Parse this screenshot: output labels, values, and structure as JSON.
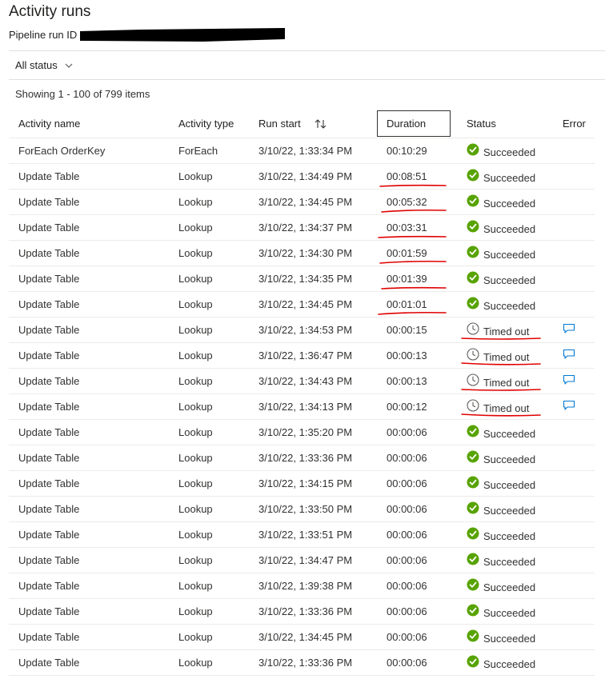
{
  "page": {
    "title": "Activity runs",
    "pipeline_label": "Pipeline run ID",
    "filter_label": "All status",
    "showing_text": "Showing 1 - 100 of 799 items"
  },
  "colors": {
    "success": "#57a300",
    "timeout_icon": "#605e5c",
    "annotation": "#e00000",
    "link": "#0078d4"
  },
  "table": {
    "headers": {
      "name": "Activity name",
      "type": "Activity type",
      "start": "Run start",
      "duration": "Duration",
      "status": "Status",
      "error": "Error"
    },
    "rows": [
      {
        "name": "ForEach OrderKey",
        "type": "ForEach",
        "start": "3/10/22, 1:33:34 PM",
        "duration": "00:10:29",
        "status": "Succeeded",
        "status_icon": "check-circle-icon",
        "has_error": false,
        "duration_marked": false,
        "status_marked": false
      },
      {
        "name": "Update Table",
        "type": "Lookup",
        "start": "3/10/22, 1:34:49 PM",
        "duration": "00:08:51",
        "status": "Succeeded",
        "status_icon": "check-circle-icon",
        "has_error": false,
        "duration_marked": true,
        "status_marked": false
      },
      {
        "name": "Update Table",
        "type": "Lookup",
        "start": "3/10/22, 1:34:45 PM",
        "duration": "00:05:32",
        "status": "Succeeded",
        "status_icon": "check-circle-icon",
        "has_error": false,
        "duration_marked": true,
        "status_marked": false
      },
      {
        "name": "Update Table",
        "type": "Lookup",
        "start": "3/10/22, 1:34:37 PM",
        "duration": "00:03:31",
        "status": "Succeeded",
        "status_icon": "check-circle-icon",
        "has_error": false,
        "duration_marked": true,
        "status_marked": false
      },
      {
        "name": "Update Table",
        "type": "Lookup",
        "start": "3/10/22, 1:34:30 PM",
        "duration": "00:01:59",
        "status": "Succeeded",
        "status_icon": "check-circle-icon",
        "has_error": false,
        "duration_marked": true,
        "status_marked": false
      },
      {
        "name": "Update Table",
        "type": "Lookup",
        "start": "3/10/22, 1:34:35 PM",
        "duration": "00:01:39",
        "status": "Succeeded",
        "status_icon": "check-circle-icon",
        "has_error": false,
        "duration_marked": true,
        "status_marked": false
      },
      {
        "name": "Update Table",
        "type": "Lookup",
        "start": "3/10/22, 1:34:45 PM",
        "duration": "00:01:01",
        "status": "Succeeded",
        "status_icon": "check-circle-icon",
        "has_error": false,
        "duration_marked": true,
        "status_marked": false
      },
      {
        "name": "Update Table",
        "type": "Lookup",
        "start": "3/10/22, 1:34:53 PM",
        "duration": "00:00:15",
        "status": "Timed out",
        "status_icon": "clock-icon",
        "has_error": true,
        "duration_marked": false,
        "status_marked": true
      },
      {
        "name": "Update Table",
        "type": "Lookup",
        "start": "3/10/22, 1:36:47 PM",
        "duration": "00:00:13",
        "status": "Timed out",
        "status_icon": "clock-icon",
        "has_error": true,
        "duration_marked": false,
        "status_marked": true
      },
      {
        "name": "Update Table",
        "type": "Lookup",
        "start": "3/10/22, 1:34:43 PM",
        "duration": "00:00:13",
        "status": "Timed out",
        "status_icon": "clock-icon",
        "has_error": true,
        "duration_marked": false,
        "status_marked": true
      },
      {
        "name": "Update Table",
        "type": "Lookup",
        "start": "3/10/22, 1:34:13 PM",
        "duration": "00:00:12",
        "status": "Timed out",
        "status_icon": "clock-icon",
        "has_error": true,
        "duration_marked": false,
        "status_marked": true
      },
      {
        "name": "Update Table",
        "type": "Lookup",
        "start": "3/10/22, 1:35:20 PM",
        "duration": "00:00:06",
        "status": "Succeeded",
        "status_icon": "check-circle-icon",
        "has_error": false,
        "duration_marked": false,
        "status_marked": false
      },
      {
        "name": "Update Table",
        "type": "Lookup",
        "start": "3/10/22, 1:33:36 PM",
        "duration": "00:00:06",
        "status": "Succeeded",
        "status_icon": "check-circle-icon",
        "has_error": false,
        "duration_marked": false,
        "status_marked": false
      },
      {
        "name": "Update Table",
        "type": "Lookup",
        "start": "3/10/22, 1:34:15 PM",
        "duration": "00:00:06",
        "status": "Succeeded",
        "status_icon": "check-circle-icon",
        "has_error": false,
        "duration_marked": false,
        "status_marked": false
      },
      {
        "name": "Update Table",
        "type": "Lookup",
        "start": "3/10/22, 1:33:50 PM",
        "duration": "00:00:06",
        "status": "Succeeded",
        "status_icon": "check-circle-icon",
        "has_error": false,
        "duration_marked": false,
        "status_marked": false
      },
      {
        "name": "Update Table",
        "type": "Lookup",
        "start": "3/10/22, 1:33:51 PM",
        "duration": "00:00:06",
        "status": "Succeeded",
        "status_icon": "check-circle-icon",
        "has_error": false,
        "duration_marked": false,
        "status_marked": false
      },
      {
        "name": "Update Table",
        "type": "Lookup",
        "start": "3/10/22, 1:34:47 PM",
        "duration": "00:00:06",
        "status": "Succeeded",
        "status_icon": "check-circle-icon",
        "has_error": false,
        "duration_marked": false,
        "status_marked": false
      },
      {
        "name": "Update Table",
        "type": "Lookup",
        "start": "3/10/22, 1:39:38 PM",
        "duration": "00:00:06",
        "status": "Succeeded",
        "status_icon": "check-circle-icon",
        "has_error": false,
        "duration_marked": false,
        "status_marked": false
      },
      {
        "name": "Update Table",
        "type": "Lookup",
        "start": "3/10/22, 1:33:36 PM",
        "duration": "00:00:06",
        "status": "Succeeded",
        "status_icon": "check-circle-icon",
        "has_error": false,
        "duration_marked": false,
        "status_marked": false
      },
      {
        "name": "Update Table",
        "type": "Lookup",
        "start": "3/10/22, 1:34:45 PM",
        "duration": "00:00:06",
        "status": "Succeeded",
        "status_icon": "check-circle-icon",
        "has_error": false,
        "duration_marked": false,
        "status_marked": false
      },
      {
        "name": "Update Table",
        "type": "Lookup",
        "start": "3/10/22, 1:33:36 PM",
        "duration": "00:00:06",
        "status": "Succeeded",
        "status_icon": "check-circle-icon",
        "has_error": false,
        "duration_marked": false,
        "status_marked": false
      }
    ]
  }
}
